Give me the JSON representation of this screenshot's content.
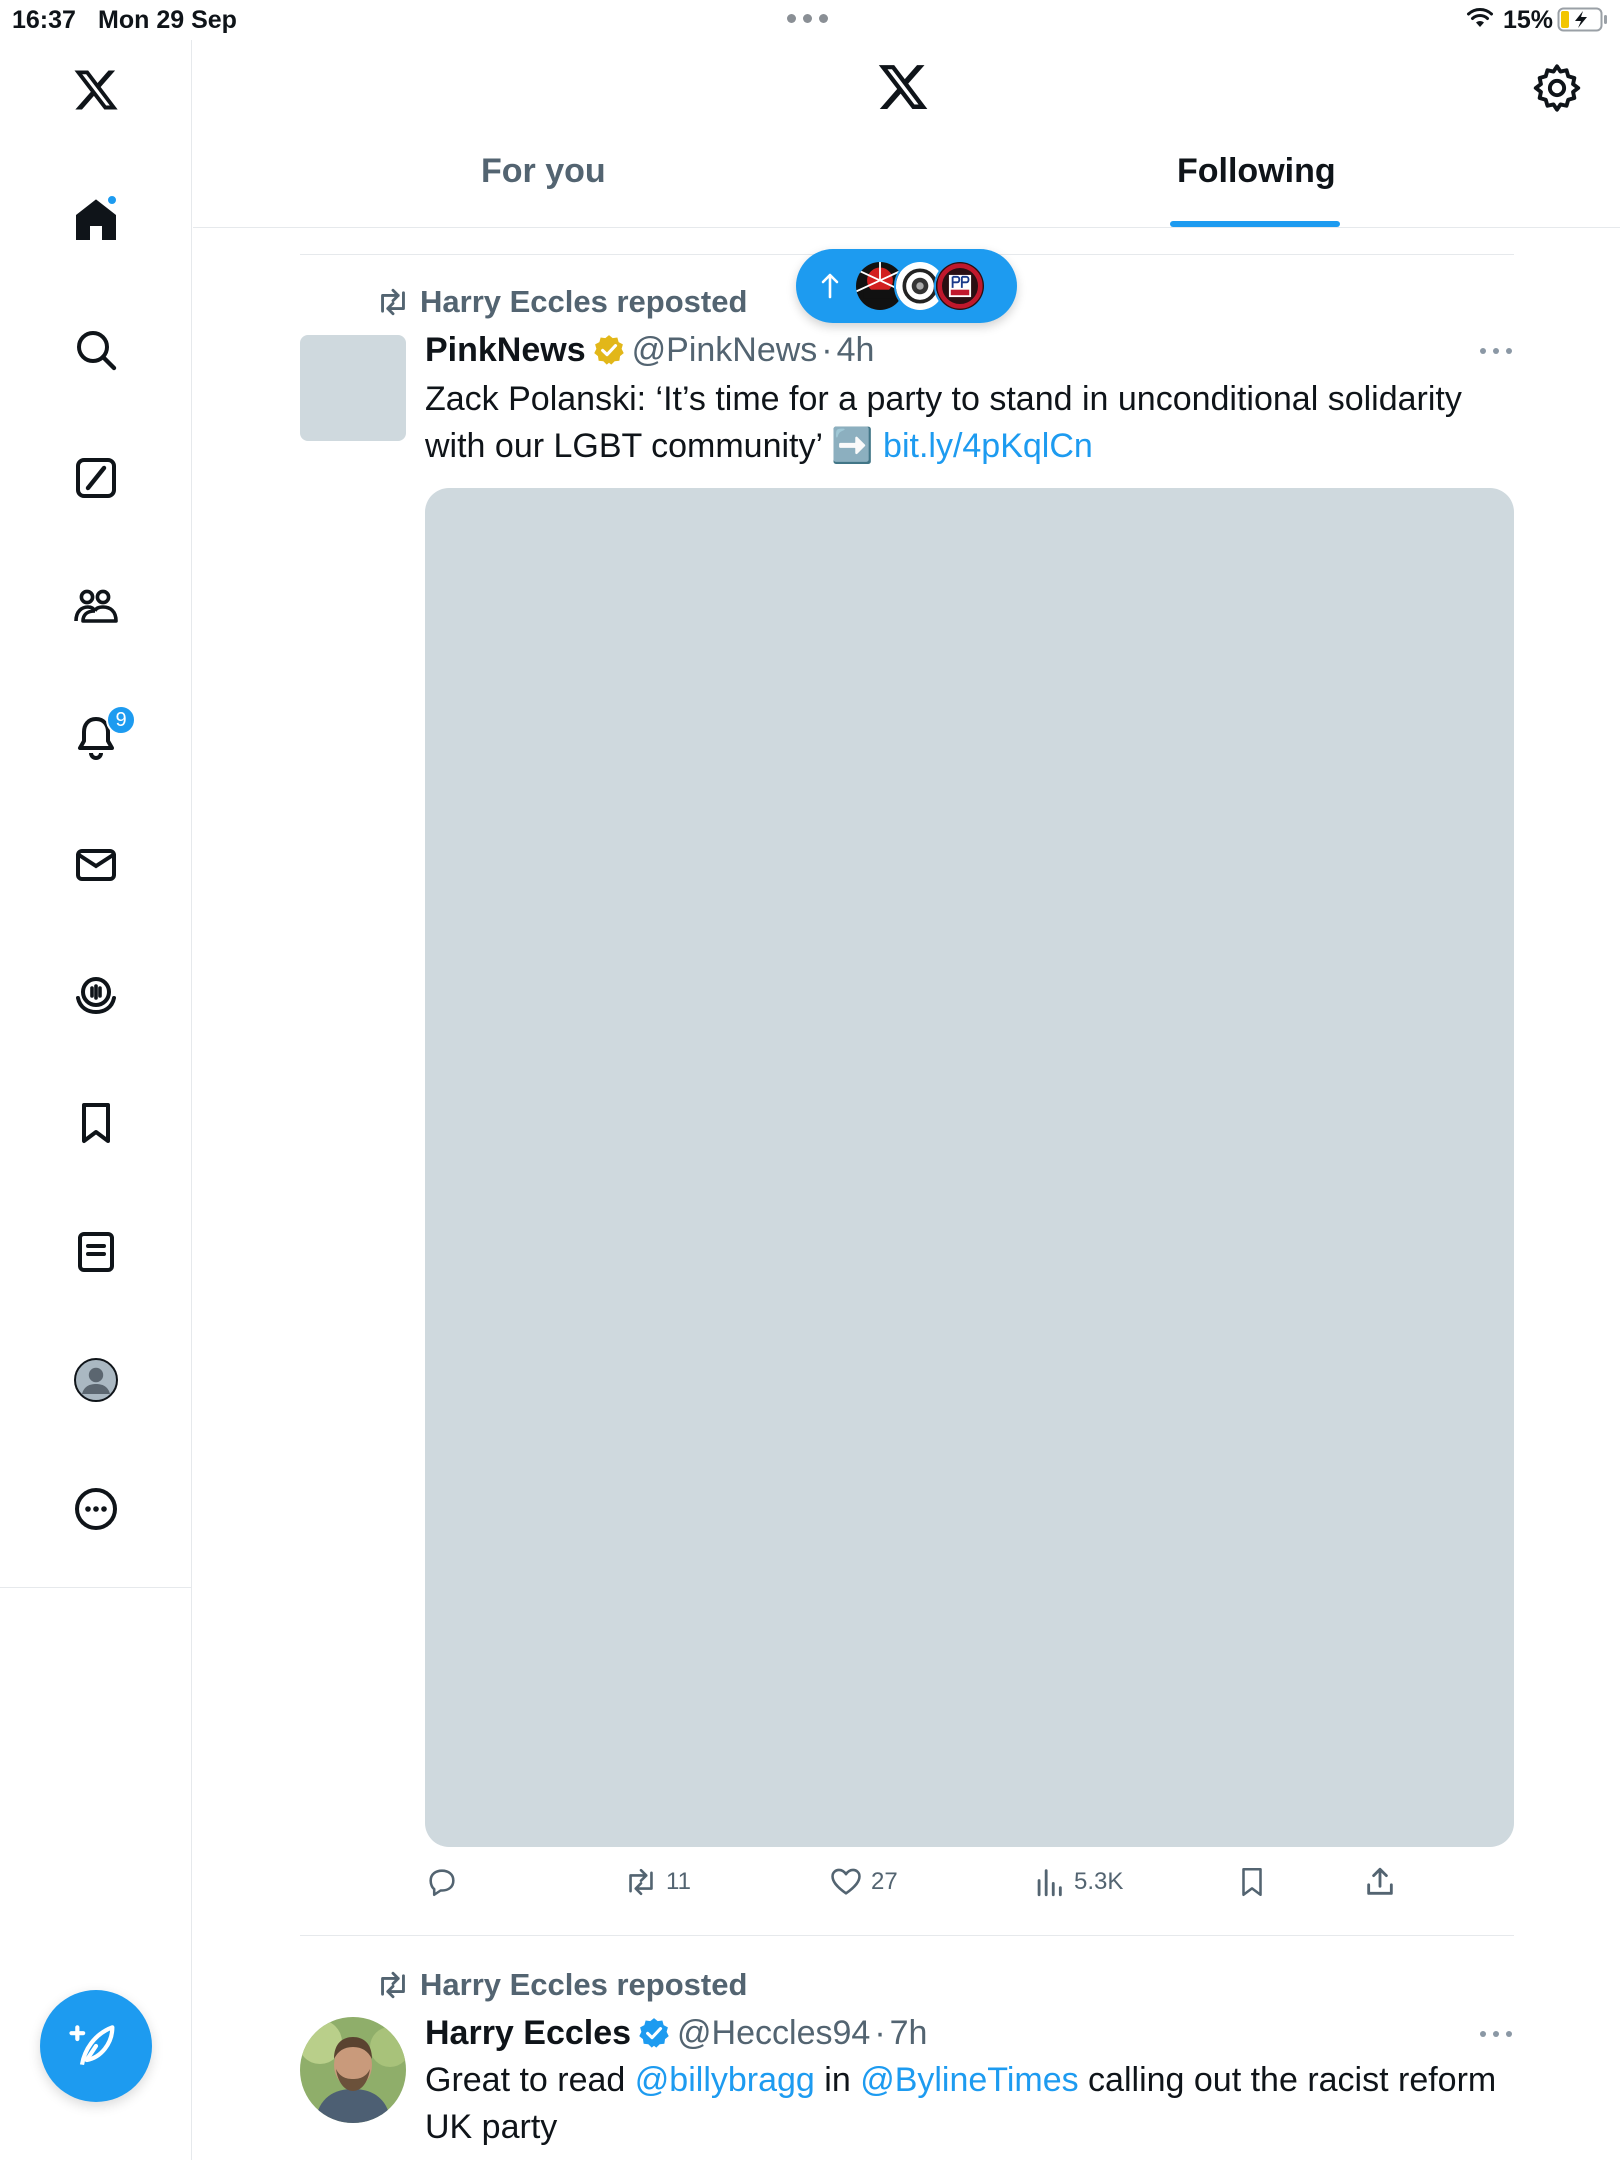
{
  "status_bar": {
    "time": "16:37",
    "date": "Mon 29 Sep",
    "battery_percent": "15%"
  },
  "sidebar": {
    "items": [
      {
        "name": "x-logo-icon"
      },
      {
        "name": "home-icon",
        "badge": ""
      },
      {
        "name": "search-icon"
      },
      {
        "name": "grok-icon"
      },
      {
        "name": "communities-icon"
      },
      {
        "name": "notifications-icon",
        "badge": "9"
      },
      {
        "name": "messages-icon"
      },
      {
        "name": "spaces-icon"
      },
      {
        "name": "bookmarks-icon"
      },
      {
        "name": "lists-icon"
      },
      {
        "name": "profile-icon"
      },
      {
        "name": "more-icon"
      }
    ],
    "compose_icon": "compose-icon"
  },
  "header": {
    "tabs": [
      {
        "label": "For you",
        "selected": false
      },
      {
        "label": "Following",
        "selected": true
      }
    ]
  },
  "new_posts_pill": {
    "arrow_icon": "arrow-up-icon",
    "avatars": [
      "avatar-1",
      "avatar-2",
      "avatar-3"
    ]
  },
  "tweets": [
    {
      "repost_label": "Harry Eccles reposted",
      "name": "PinkNews",
      "verified": "gold",
      "handle": "@PinkNews",
      "separator": "·",
      "time": "4h",
      "text_line1": "Zack Polanski: ‘It’s time for a party to stand in unconditional solidarity",
      "text_line2": "with our LGBT community’",
      "emoji": "➡️",
      "link": "bit.ly/4pKqlCn",
      "stats": {
        "replies": "",
        "reposts": "11",
        "likes": "27",
        "views": "5.3K"
      }
    },
    {
      "repost_label": "Harry Eccles reposted",
      "name": "Harry Eccles",
      "verified": "blue",
      "handle": "@Heccles94",
      "separator": "·",
      "time": "7h",
      "text_pre": "Great to read ",
      "mention1": "@billybragg",
      "text_mid": " in ",
      "mention2": "@BylineTimes",
      "text_post": " calling out the racist reform",
      "text_line2": "UK party"
    }
  ],
  "colors": {
    "accent": "#1d9bf0",
    "text": "#0f1419",
    "secondary": "#536471",
    "placeholder": "#cfd9de",
    "gold_badge": "#e2b719"
  }
}
